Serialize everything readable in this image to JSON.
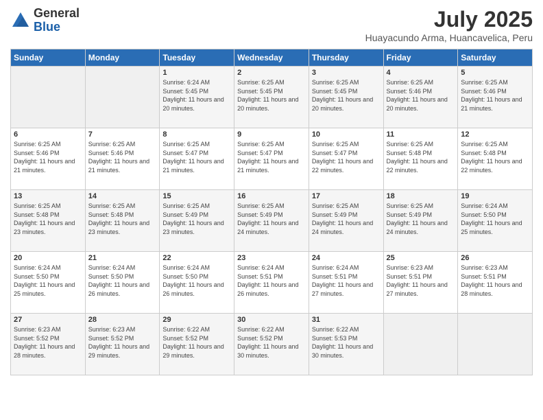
{
  "logo": {
    "general": "General",
    "blue": "Blue"
  },
  "title": "July 2025",
  "location": "Huayacundo Arma, Huancavelica, Peru",
  "weekdays": [
    "Sunday",
    "Monday",
    "Tuesday",
    "Wednesday",
    "Thursday",
    "Friday",
    "Saturday"
  ],
  "weeks": [
    [
      {
        "day": "",
        "info": ""
      },
      {
        "day": "",
        "info": ""
      },
      {
        "day": "1",
        "info": "Sunrise: 6:24 AM\nSunset: 5:45 PM\nDaylight: 11 hours and 20 minutes."
      },
      {
        "day": "2",
        "info": "Sunrise: 6:25 AM\nSunset: 5:45 PM\nDaylight: 11 hours and 20 minutes."
      },
      {
        "day": "3",
        "info": "Sunrise: 6:25 AM\nSunset: 5:45 PM\nDaylight: 11 hours and 20 minutes."
      },
      {
        "day": "4",
        "info": "Sunrise: 6:25 AM\nSunset: 5:46 PM\nDaylight: 11 hours and 20 minutes."
      },
      {
        "day": "5",
        "info": "Sunrise: 6:25 AM\nSunset: 5:46 PM\nDaylight: 11 hours and 21 minutes."
      }
    ],
    [
      {
        "day": "6",
        "info": "Sunrise: 6:25 AM\nSunset: 5:46 PM\nDaylight: 11 hours and 21 minutes."
      },
      {
        "day": "7",
        "info": "Sunrise: 6:25 AM\nSunset: 5:46 PM\nDaylight: 11 hours and 21 minutes."
      },
      {
        "day": "8",
        "info": "Sunrise: 6:25 AM\nSunset: 5:47 PM\nDaylight: 11 hours and 21 minutes."
      },
      {
        "day": "9",
        "info": "Sunrise: 6:25 AM\nSunset: 5:47 PM\nDaylight: 11 hours and 21 minutes."
      },
      {
        "day": "10",
        "info": "Sunrise: 6:25 AM\nSunset: 5:47 PM\nDaylight: 11 hours and 22 minutes."
      },
      {
        "day": "11",
        "info": "Sunrise: 6:25 AM\nSunset: 5:48 PM\nDaylight: 11 hours and 22 minutes."
      },
      {
        "day": "12",
        "info": "Sunrise: 6:25 AM\nSunset: 5:48 PM\nDaylight: 11 hours and 22 minutes."
      }
    ],
    [
      {
        "day": "13",
        "info": "Sunrise: 6:25 AM\nSunset: 5:48 PM\nDaylight: 11 hours and 23 minutes."
      },
      {
        "day": "14",
        "info": "Sunrise: 6:25 AM\nSunset: 5:48 PM\nDaylight: 11 hours and 23 minutes."
      },
      {
        "day": "15",
        "info": "Sunrise: 6:25 AM\nSunset: 5:49 PM\nDaylight: 11 hours and 23 minutes."
      },
      {
        "day": "16",
        "info": "Sunrise: 6:25 AM\nSunset: 5:49 PM\nDaylight: 11 hours and 24 minutes."
      },
      {
        "day": "17",
        "info": "Sunrise: 6:25 AM\nSunset: 5:49 PM\nDaylight: 11 hours and 24 minutes."
      },
      {
        "day": "18",
        "info": "Sunrise: 6:25 AM\nSunset: 5:49 PM\nDaylight: 11 hours and 24 minutes."
      },
      {
        "day": "19",
        "info": "Sunrise: 6:24 AM\nSunset: 5:50 PM\nDaylight: 11 hours and 25 minutes."
      }
    ],
    [
      {
        "day": "20",
        "info": "Sunrise: 6:24 AM\nSunset: 5:50 PM\nDaylight: 11 hours and 25 minutes."
      },
      {
        "day": "21",
        "info": "Sunrise: 6:24 AM\nSunset: 5:50 PM\nDaylight: 11 hours and 26 minutes."
      },
      {
        "day": "22",
        "info": "Sunrise: 6:24 AM\nSunset: 5:50 PM\nDaylight: 11 hours and 26 minutes."
      },
      {
        "day": "23",
        "info": "Sunrise: 6:24 AM\nSunset: 5:51 PM\nDaylight: 11 hours and 26 minutes."
      },
      {
        "day": "24",
        "info": "Sunrise: 6:24 AM\nSunset: 5:51 PM\nDaylight: 11 hours and 27 minutes."
      },
      {
        "day": "25",
        "info": "Sunrise: 6:23 AM\nSunset: 5:51 PM\nDaylight: 11 hours and 27 minutes."
      },
      {
        "day": "26",
        "info": "Sunrise: 6:23 AM\nSunset: 5:51 PM\nDaylight: 11 hours and 28 minutes."
      }
    ],
    [
      {
        "day": "27",
        "info": "Sunrise: 6:23 AM\nSunset: 5:52 PM\nDaylight: 11 hours and 28 minutes."
      },
      {
        "day": "28",
        "info": "Sunrise: 6:23 AM\nSunset: 5:52 PM\nDaylight: 11 hours and 29 minutes."
      },
      {
        "day": "29",
        "info": "Sunrise: 6:22 AM\nSunset: 5:52 PM\nDaylight: 11 hours and 29 minutes."
      },
      {
        "day": "30",
        "info": "Sunrise: 6:22 AM\nSunset: 5:52 PM\nDaylight: 11 hours and 30 minutes."
      },
      {
        "day": "31",
        "info": "Sunrise: 6:22 AM\nSunset: 5:53 PM\nDaylight: 11 hours and 30 minutes."
      },
      {
        "day": "",
        "info": ""
      },
      {
        "day": "",
        "info": ""
      }
    ]
  ]
}
